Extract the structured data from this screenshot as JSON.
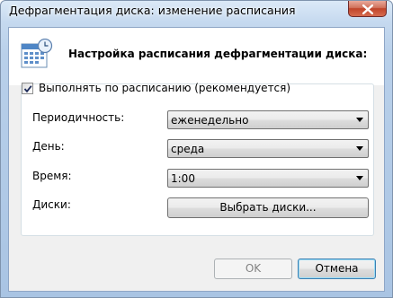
{
  "window": {
    "title": "Дефрагментация диска: изменение расписания"
  },
  "header": {
    "icon": "calendar-clock-icon",
    "text": "Настройка расписания дефрагментации диска:"
  },
  "schedule": {
    "enabled_label": "Выполнять по расписанию (рекомендуется)",
    "enabled": true
  },
  "fields": {
    "frequency": {
      "label": "Периодичность:",
      "value": "еженедельно"
    },
    "day": {
      "label": "День:",
      "value": "среда"
    },
    "time": {
      "label": "Время:",
      "value": "1:00"
    },
    "disks": {
      "label": "Диски:",
      "button": "Выбрать диски..."
    }
  },
  "buttons": {
    "ok": "OK",
    "cancel": "Отмена"
  }
}
